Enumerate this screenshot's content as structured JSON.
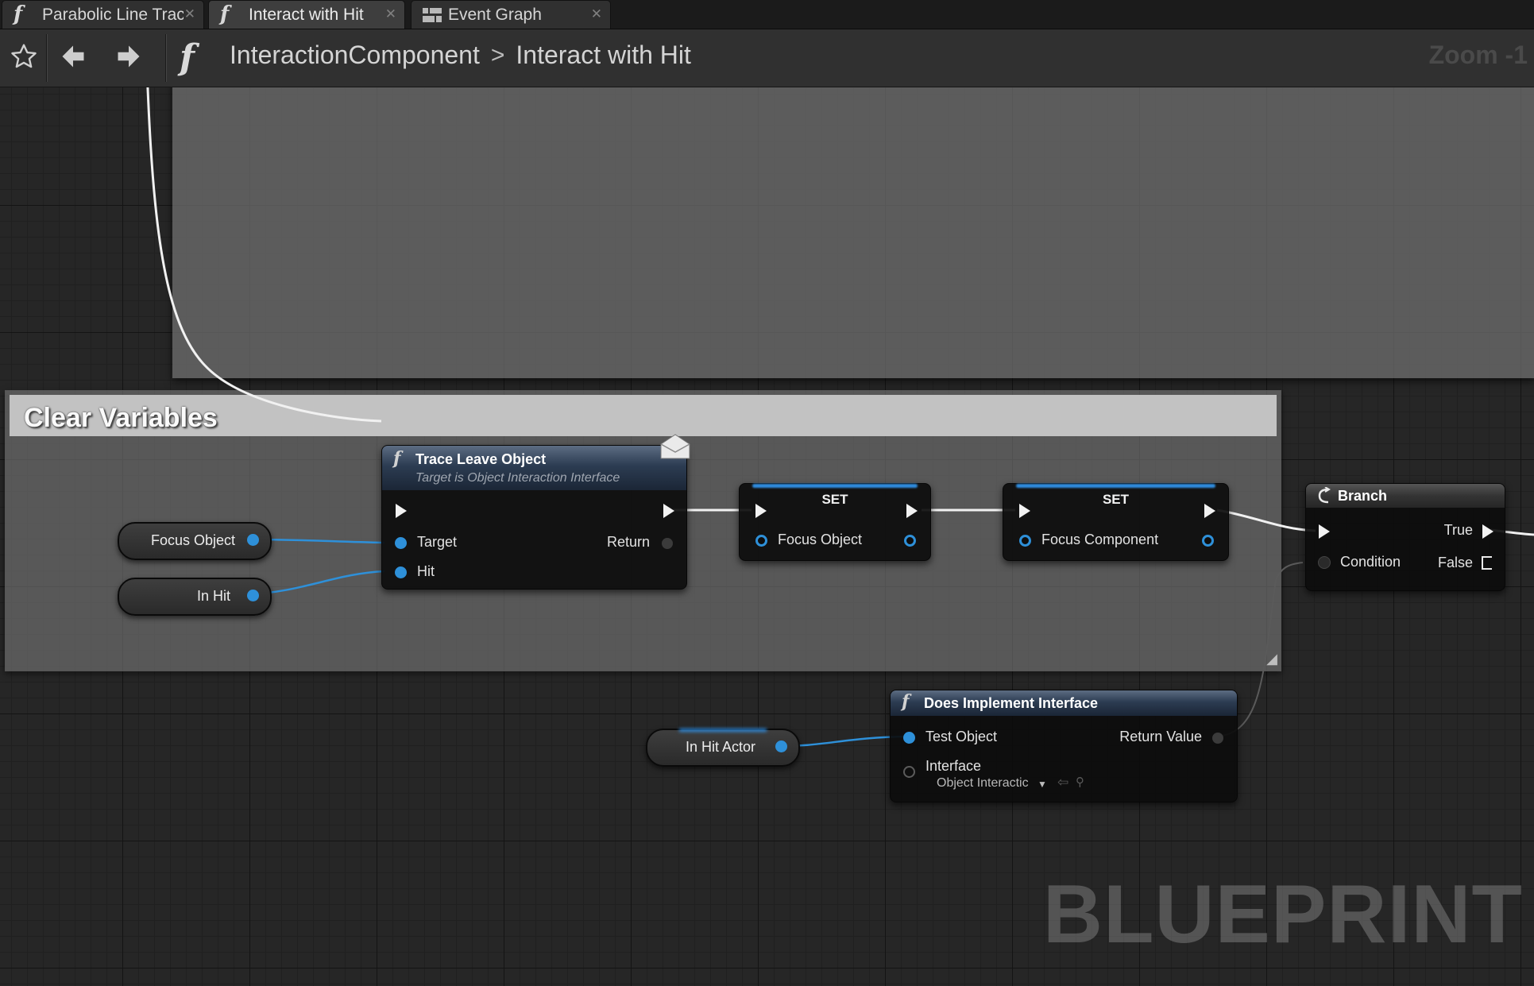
{
  "tabs": [
    {
      "label": "Parabolic Line Trac",
      "icon": "function-icon"
    },
    {
      "label": "Interact with Hit",
      "icon": "function-icon"
    },
    {
      "label": "Event Graph",
      "icon": "event-graph-icon"
    }
  ],
  "toolbar": {
    "breadcrumbs": [
      "InteractionComponent",
      "Interact with Hit"
    ],
    "zoom": "Zoom -1"
  },
  "graph": {
    "comment_clear_title": "Clear Variables",
    "watermark": "BLUEPRINT",
    "nodes": {
      "trace_leave": {
        "title": "Trace Leave Object",
        "subtitle": "Target is Object Interaction Interface",
        "pin_target": "Target",
        "pin_hit": "Hit",
        "pin_return": "Return"
      },
      "set1": {
        "title": "SET",
        "pin": "Focus Object"
      },
      "set2": {
        "title": "SET",
        "pin": "Focus Component"
      },
      "branch": {
        "title": "Branch",
        "pin_condition": "Condition",
        "pin_true": "True",
        "pin_false": "False"
      },
      "does_implement": {
        "title": "Does Implement Interface",
        "pin_test": "Test Object",
        "pin_return": "Return Value",
        "pin_interface": "Interface",
        "interface_value": "Object Interactic"
      }
    },
    "variables": {
      "focus_object": "Focus Object",
      "in_hit": "In Hit",
      "in_hit_actor": "In Hit Actor"
    }
  },
  "colors": {
    "accent_blue": "#2e90d9",
    "graph_bg": "#262626"
  }
}
